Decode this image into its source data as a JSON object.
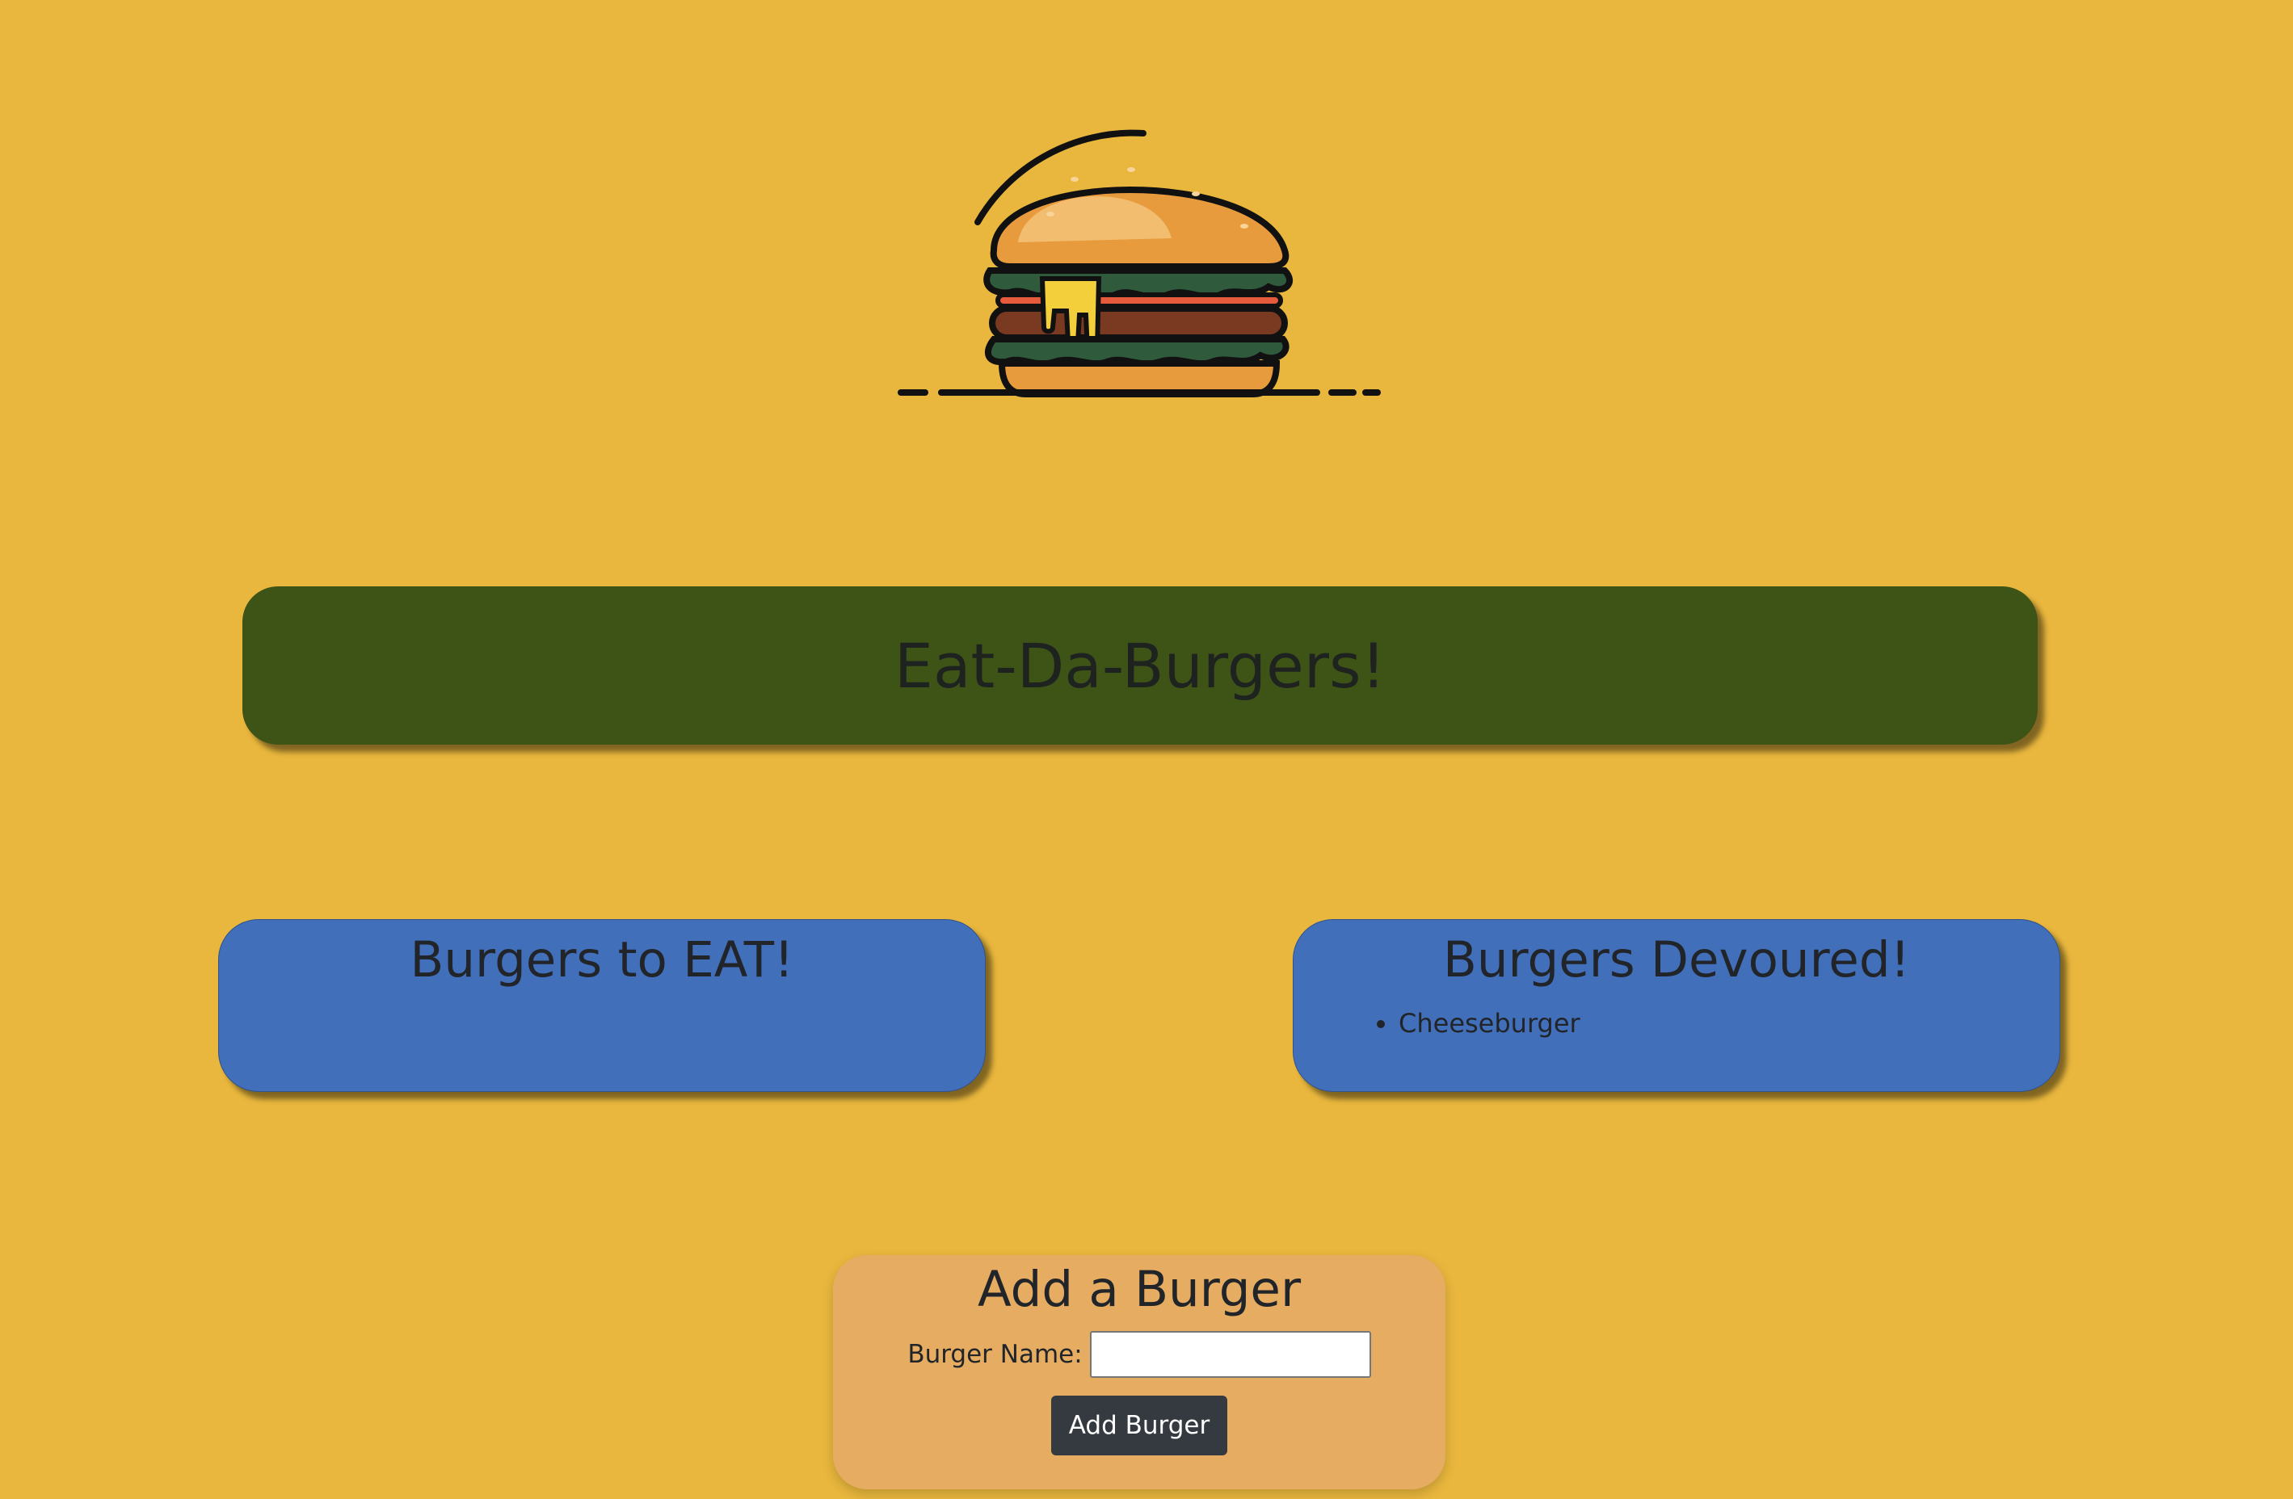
{
  "header": {
    "title": "Eat-Da-Burgers!",
    "logo_icon": "burger-icon"
  },
  "to_eat": {
    "title": "Burgers to EAT!",
    "items": []
  },
  "devoured": {
    "title": "Burgers Devoured!",
    "items": [
      "Cheeseburger"
    ]
  },
  "add_form": {
    "title": "Add a Burger",
    "name_label": "Burger Name:",
    "name_value": "",
    "submit_label": "Add Burger"
  },
  "colors": {
    "background": "#E9B73D",
    "jumbotron": "#3E5417",
    "panels": "#426FB9",
    "form_card": "#E6AC62",
    "button": "#343A40"
  }
}
